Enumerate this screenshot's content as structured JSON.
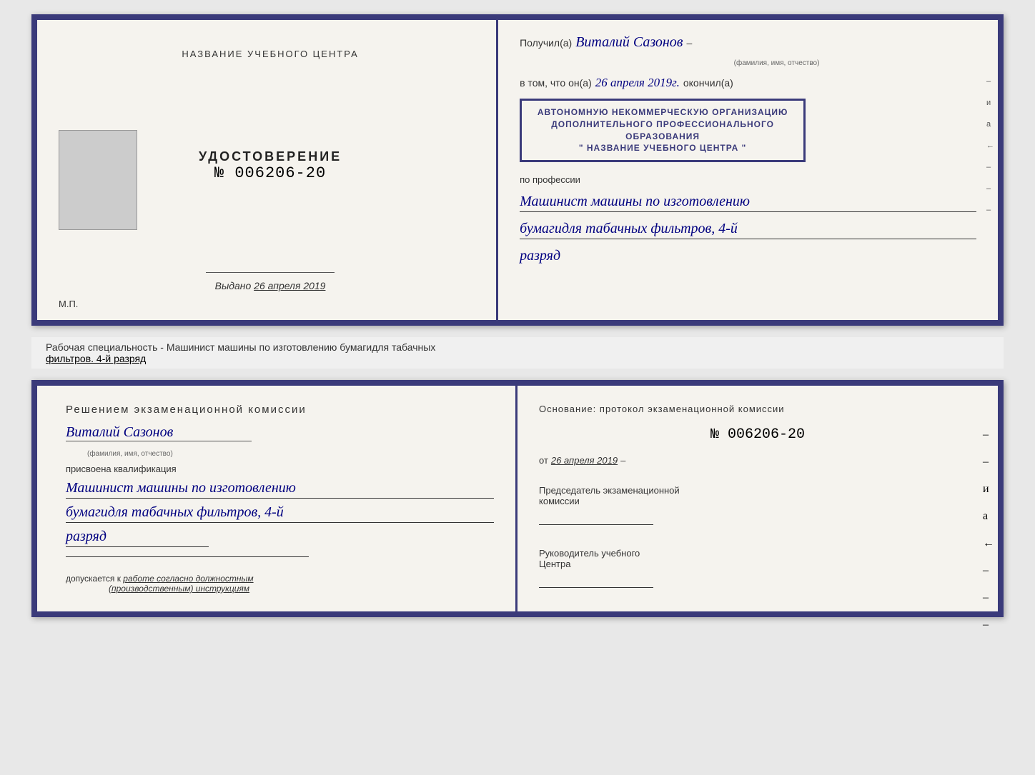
{
  "diploma": {
    "left": {
      "center_title": "НАЗВАНИЕ УЧЕБНОГО ЦЕНТРА",
      "udostoverenie": "УДОСТОВЕРЕНИЕ",
      "number": "№ 006206-20",
      "vydano_label": "Выдано",
      "vydano_date": "26 апреля 2019",
      "mp_label": "М.П."
    },
    "right": {
      "poluchil_prefix": "Получил(а)",
      "poluchil_name": "Виталий Сазонов",
      "poluchil_sub": "(фамилия, имя, отчество)",
      "vtom_prefix": "в том, что он(а)",
      "vtom_date": "26 апреля 2019г.",
      "okonchil": "окончил(а)",
      "stamp_line1": "АВТОНОМНУЮ НЕКОММЕРЧЕСКУЮ ОРГАНИЗАЦИЮ",
      "stamp_line2": "ДОПОЛНИТЕЛЬНОГО ПРОФЕССИОНАЛЬНОГО ОБРАЗОВАНИЯ",
      "stamp_line3": "\" НАЗВАНИЕ УЧЕБНОГО ЦЕНТРА \"",
      "poprofessii": "по профессии",
      "professiya_line1": "Машинист машины по изготовлению",
      "professiya_line2": "бумагидля табачных фильтров, 4-й",
      "professiya_line3": "разряд"
    },
    "side_labels": [
      "–",
      "и",
      "а",
      "←",
      "–",
      "–",
      "–"
    ]
  },
  "annotation": {
    "text_normal": "Рабочая специальность - Машинист машины по изготовлению бумагидля табачных",
    "text_underline": "фильтров. 4-й разряд"
  },
  "bottom": {
    "left": {
      "komissia_title": "Решением  экзаменационной  комиссии",
      "name": "Виталий Сазонов",
      "name_sub": "(фамилия, имя, отчество)",
      "prisvoena": "присвоена квалификация",
      "kval_line1": "Машинист машины по изготовлению",
      "kval_line2": "бумагидля табачных фильтров, 4-й",
      "kval_line3": "разряд",
      "dopuskaetsya": "допускается к",
      "dopusk_italic": "работе согласно должностным",
      "dopusk_italic2": "(производственным) инструкциям"
    },
    "right": {
      "osnovanie": "Основание:  протокол  экзаменационной  комиссии",
      "number": "№  006206-20",
      "ot_prefix": "от",
      "ot_date": "26 апреля 2019",
      "predsedatel_line1": "Председатель экзаменационной",
      "predsedatel_line2": "комиссии",
      "rukovoditel_line1": "Руководитель учебного",
      "rukovoditel_line2": "Центра"
    },
    "side_labels": [
      "–",
      "–",
      "и",
      "а",
      "←",
      "–",
      "–",
      "–"
    ]
  }
}
